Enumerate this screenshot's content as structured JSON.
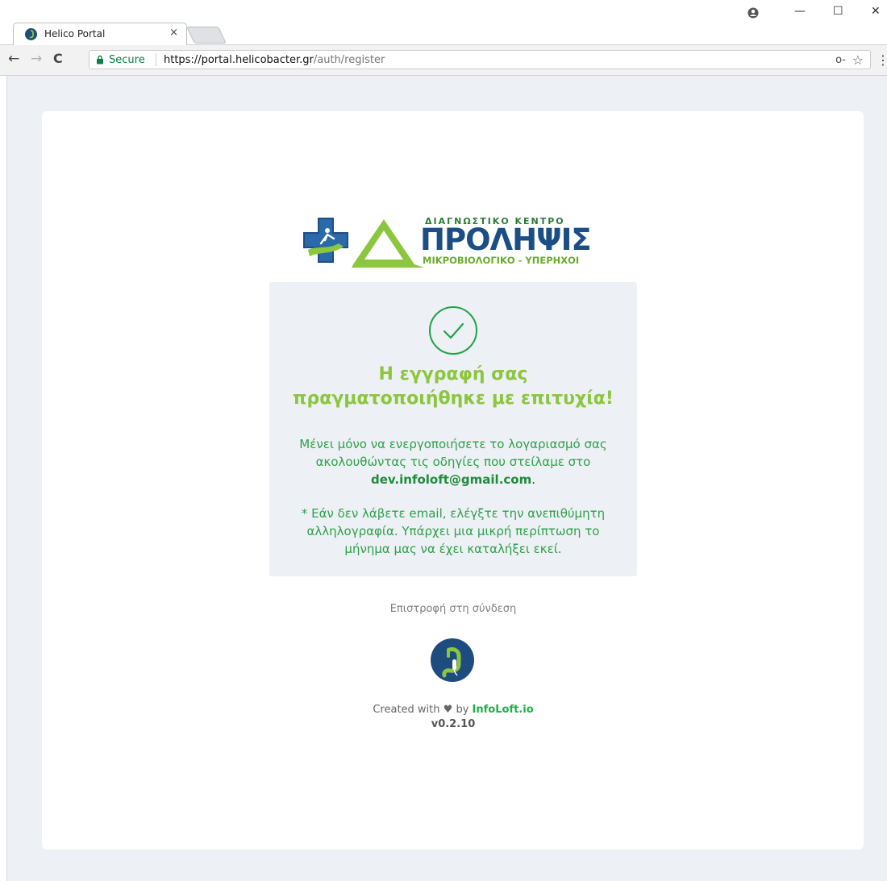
{
  "browser": {
    "tab_title": "Helico Portal",
    "tab_close": "×",
    "secure_label": "Secure",
    "url_host": "https://portal.helicobacter.gr",
    "url_path": "/auth/register",
    "window_controls": {
      "minimize": "—",
      "maximize": "☐",
      "close": "✕"
    },
    "nav": {
      "back": "←",
      "forward": "→",
      "reload": "C"
    },
    "icons": {
      "key": "key-icon",
      "star": "star-icon",
      "menu": "menu-icon"
    },
    "key_glyph": "o-",
    "star_glyph": "☆",
    "menu_glyph": "⋮"
  },
  "logo": {
    "line1": "ΔΙΑΓΝΩΣΤΙΚΟ ΚΕΝΤΡΟ",
    "line2": "ΠΡΟΛΗΨΙΣ",
    "line3": "ΜΙΚΡΟΒΙΟΛΟΓΙΚΟ - ΥΠΕΡΗΧΟΙ"
  },
  "success": {
    "title_line1": "Η εγγραφή σας",
    "title_line2": "πραγματοποιήθηκε με επιτυχία!",
    "message_line1": "Μένει μόνο να ενεργοποιήσετε το λογαριασμό σας",
    "message_line2": "ακολουθώντας τις οδηγίες που στείλαμε στο",
    "email": "dev.infoloft@gmail.com",
    "email_suffix": ".",
    "note_line1": "* Εάν δεν λάβετε email, ελέγξτε την ανεπιθύμητη",
    "note_line2": "αλληλογραφία. Υπάρχει μια μικρή περίπτωση το",
    "note_line3": "μήνημα μας να έχει καταλήξει εκεί."
  },
  "back_link": "Επιστροφή στη σύνδεση",
  "footer": {
    "created_with": "Created with",
    "heart": "♥",
    "by": "by",
    "brand": "InfoLoft.io",
    "version": "v0.2.10"
  },
  "colors": {
    "accent_green": "#8cc63f",
    "text_green": "#2fa04a",
    "brand_blue": "#1c4e86",
    "page_bg": "#edf1f6"
  }
}
